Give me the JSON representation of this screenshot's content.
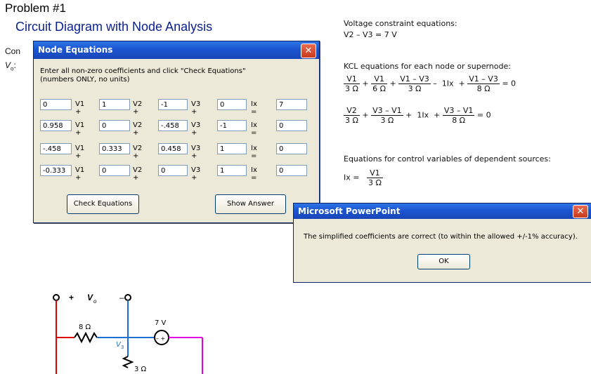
{
  "slide": {
    "title": "Problem #1",
    "subtitle": "Circuit Diagram with Node Analysis",
    "hidden_text_1": "Con",
    "hidden_text_2": "V",
    "hidden_text_2_sub": "o",
    "hidden_text_2_tail": ":"
  },
  "right_panel": {
    "voltage_heading": "Voltage constraint equations:",
    "voltage_eq": "V2 – V3 = 7 V",
    "kcl_heading": "KCL equations for each node or supernode:",
    "control_heading": "Equations for control variables of dependent sources:",
    "eq1": {
      "t1_num": "V1",
      "t1_den": "3 Ω",
      "t2_num": "V1",
      "t2_den": "6 Ω",
      "t3_num": "V1 – V3",
      "t3_den": "3 Ω",
      "t4": "1Ix",
      "t5_num": "V1 – V3",
      "t5_den": "8 Ω",
      "rhs": "= 0"
    },
    "eq2": {
      "t1_num": "V2",
      "t1_den": "3 Ω",
      "t2_num": "V3 – V1",
      "t2_den": "3 Ω",
      "t3": "1Ix",
      "t4_num": "V3 – V1",
      "t4_den": "8 Ω",
      "rhs": "= 0"
    },
    "ctrl": {
      "lhs": "Ix =",
      "num": "V1",
      "den": "3 Ω"
    }
  },
  "dialog": {
    "title": "Node Equations",
    "close": "✕",
    "instruction_line1": "Enter all non-zero coefficients and click \"Check Equations\"",
    "instruction_line2": "(numbers ONLY, no units)",
    "labels": {
      "v1": "V1 +",
      "v2": "V2 +",
      "v3": "V3 +",
      "ix": "Ix ="
    },
    "rows": [
      {
        "v1": "0",
        "v2": "1",
        "v3": "-1",
        "ix": "0",
        "rhs": "7"
      },
      {
        "v1": "0.958",
        "v2": "0",
        "v3": "-.458",
        "ix": "-1",
        "rhs": "0"
      },
      {
        "v1": "-.458",
        "v2": "0.333",
        "v3": "0.458",
        "ix": "1",
        "rhs": "0"
      },
      {
        "v1": "-0.333",
        "v2": "0",
        "v3": "0",
        "ix": "1",
        "rhs": "0"
      }
    ],
    "check_button": "Check Equations",
    "show_button": "Show Answer"
  },
  "msgbox": {
    "title": "Microsoft PowerPoint",
    "close": "✕",
    "message": "The simplified coefficients are correct (to within the allowed +/-1% accuracy).",
    "ok": "OK"
  },
  "circuit": {
    "plus": "+",
    "minus": "–",
    "vo": "V",
    "vo_sub": "o",
    "r1": "8 Ω",
    "r2": "3 Ω",
    "src": "7 V",
    "v3": "V",
    "v3_sub": "3",
    "src_sign": "– +"
  }
}
